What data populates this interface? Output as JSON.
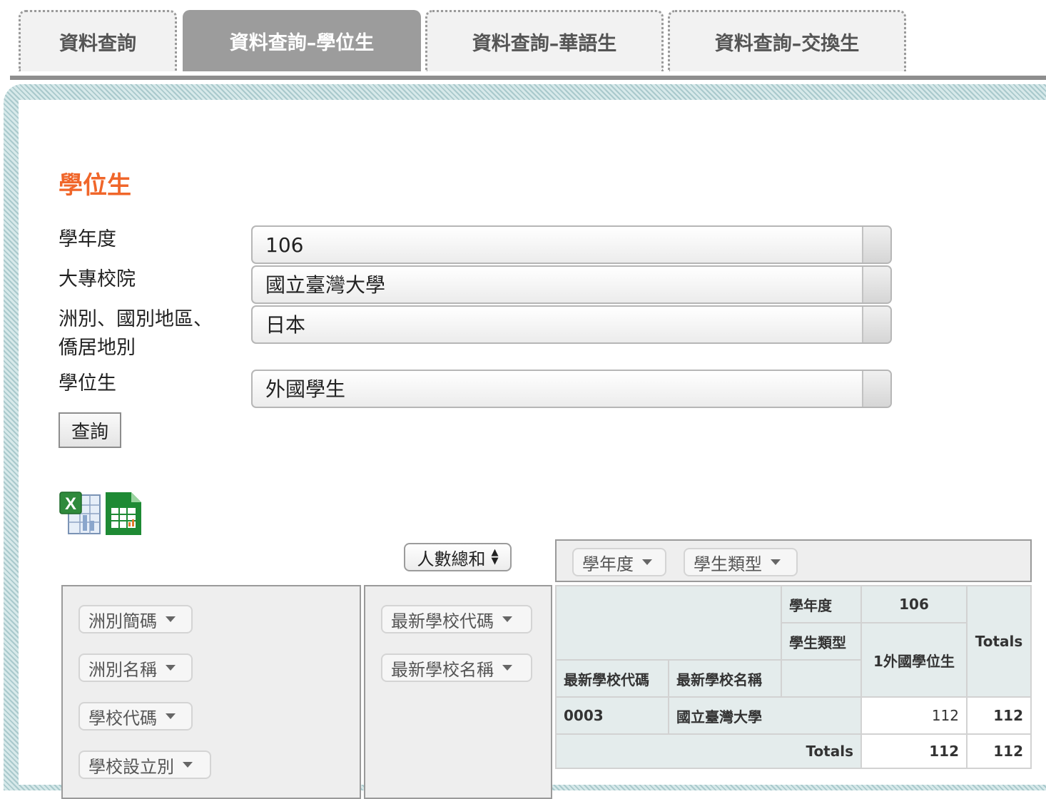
{
  "tabs": [
    {
      "label": "資料查詢",
      "active": false
    },
    {
      "label": "資料查詢–學位生",
      "active": true
    },
    {
      "label": "資料查詢–華語生",
      "active": false
    },
    {
      "label": "資料查詢–交換生",
      "active": false
    }
  ],
  "section_title": "學位生",
  "form": {
    "year": {
      "label": "學年度",
      "value": "106"
    },
    "school": {
      "label": "大專校院",
      "value": "國立臺灣大學"
    },
    "region": {
      "label_line1": "洲別、國別地區、",
      "label_line2": "僑居地別",
      "value": "日本"
    },
    "degree": {
      "label": "學位生",
      "value": "外國學生"
    },
    "query_button": "查詢"
  },
  "exports": [
    "excel-export-icon",
    "spreadsheet-export-icon"
  ],
  "pivot": {
    "aggregator": "人數總和",
    "col_fields": [
      "學年度",
      "學生類型"
    ],
    "unused_fields": [
      "洲別簡碼",
      "洲別名稱",
      "學校代碼",
      "學校設立別"
    ],
    "row_fields": [
      "最新學校代碼",
      "最新學校名稱"
    ],
    "table": {
      "col_header_year_label": "學年度",
      "col_header_year_value": "106",
      "col_header_type_label": "學生類型",
      "col_header_type_value": "1外國學位生",
      "totals_label": "Totals",
      "row_header_code": "最新學校代碼",
      "row_header_name": "最新學校名稱",
      "rows": [
        {
          "code": "0003",
          "name": "國立臺灣大學",
          "value": "112",
          "total": "112"
        }
      ],
      "totals_row": {
        "label": "Totals",
        "value": "112",
        "total": "112"
      }
    }
  },
  "colors": {
    "section_title": "#f0662a",
    "active_tab": "#9c9c9c",
    "frame_stripes": "#a9c9cc",
    "table_header": "#e4ecec"
  }
}
